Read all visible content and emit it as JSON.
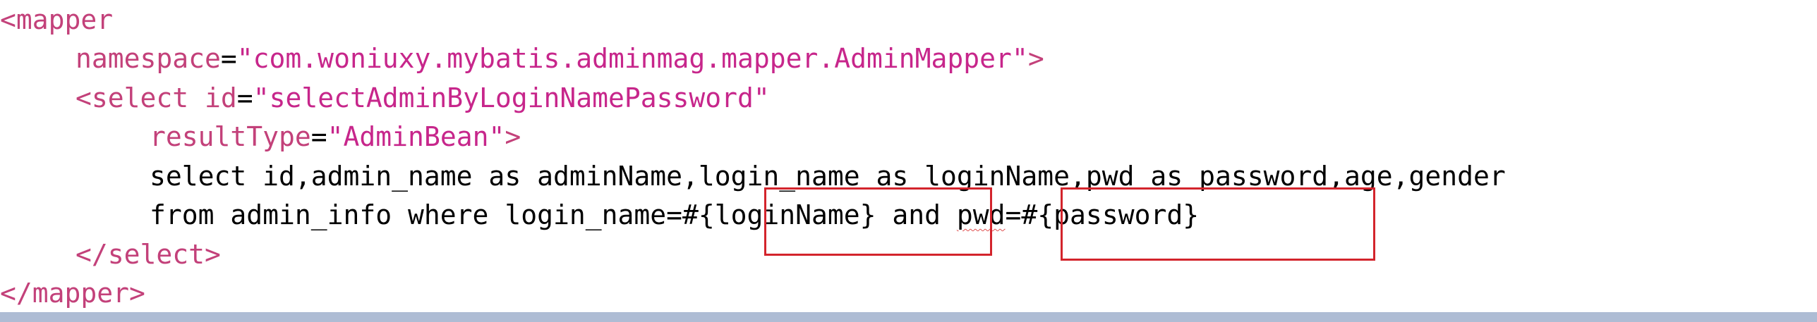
{
  "code": {
    "line1": {
      "open": "<mapper"
    },
    "line2": {
      "attr": "namespace",
      "eq": "=",
      "value": "\"com.woniuxy.mybatis.adminmag.mapper.AdminMapper\"",
      "close": ">"
    },
    "line3": {
      "open": "<select",
      "attr": " id",
      "eq": "=",
      "value": "\"selectAdminByLoginNamePassword\""
    },
    "line4": {
      "attr": "resultType",
      "eq": "=",
      "value": "\"AdminBean\"",
      "close": ">"
    },
    "line5": {
      "sql": "select id,admin_name as adminName,login_name as loginName,pwd as password,age,gender"
    },
    "line6": {
      "sql_a": "from admin_info where login_name=#{loginName} and ",
      "sql_b": "pwd",
      "sql_c": "=#{password}"
    },
    "line7": {
      "close": "</select>"
    },
    "line8": {
      "close": "</mapper>"
    }
  },
  "colors": {
    "tag": "#c3417a",
    "string": "#c7268b",
    "highlight_box": "#d3242c",
    "status_bar": "#aebcd4"
  }
}
